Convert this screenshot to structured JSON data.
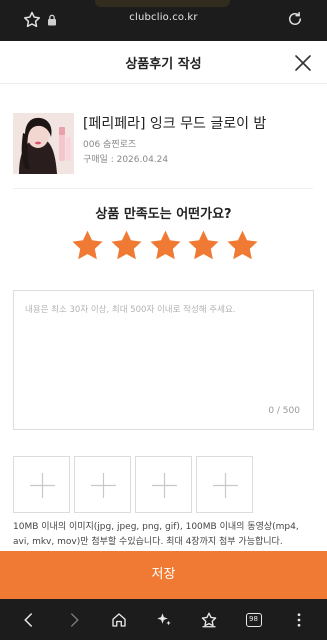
{
  "browser": {
    "url": "clubclio.co.kr",
    "tab_count": "98"
  },
  "modal": {
    "title": "상품후기 작성"
  },
  "product": {
    "name": "[페리페라] 잉크 무드 글로이 밤",
    "option": "006 숨찐로즈",
    "purchase_date": "구매일 : 2026.04.24"
  },
  "rating": {
    "question": "상품 만족도는 어떤가요?",
    "value": 5,
    "max": 5,
    "star_color": "#f07a33"
  },
  "review": {
    "placeholder": "내용은 최소 30자 이상, 최대 500자 이내로 작성해 주세요.",
    "value": "",
    "counter": "0 / 500"
  },
  "upload": {
    "slots": 4,
    "note": "10MB 이내의 이미지(jpg, jpeg, png, gif), 100MB 이내의 동영상(mp4, avi, mkv, mov)만 첨부할 수있습니다. 최대 4장까지 첨부 가능합니다."
  },
  "actions": {
    "save_label": "저장",
    "accent": "#f07a33"
  },
  "icons": {
    "browser": [
      "star-icon",
      "lock-icon",
      "reload-icon"
    ],
    "header": [
      "close-icon"
    ],
    "upload": [
      "plus-icon"
    ],
    "nav": [
      "back-icon",
      "forward-icon",
      "home-icon",
      "sparkle-icon",
      "bookmark-star-icon",
      "tabs-icon",
      "more-icon"
    ]
  }
}
